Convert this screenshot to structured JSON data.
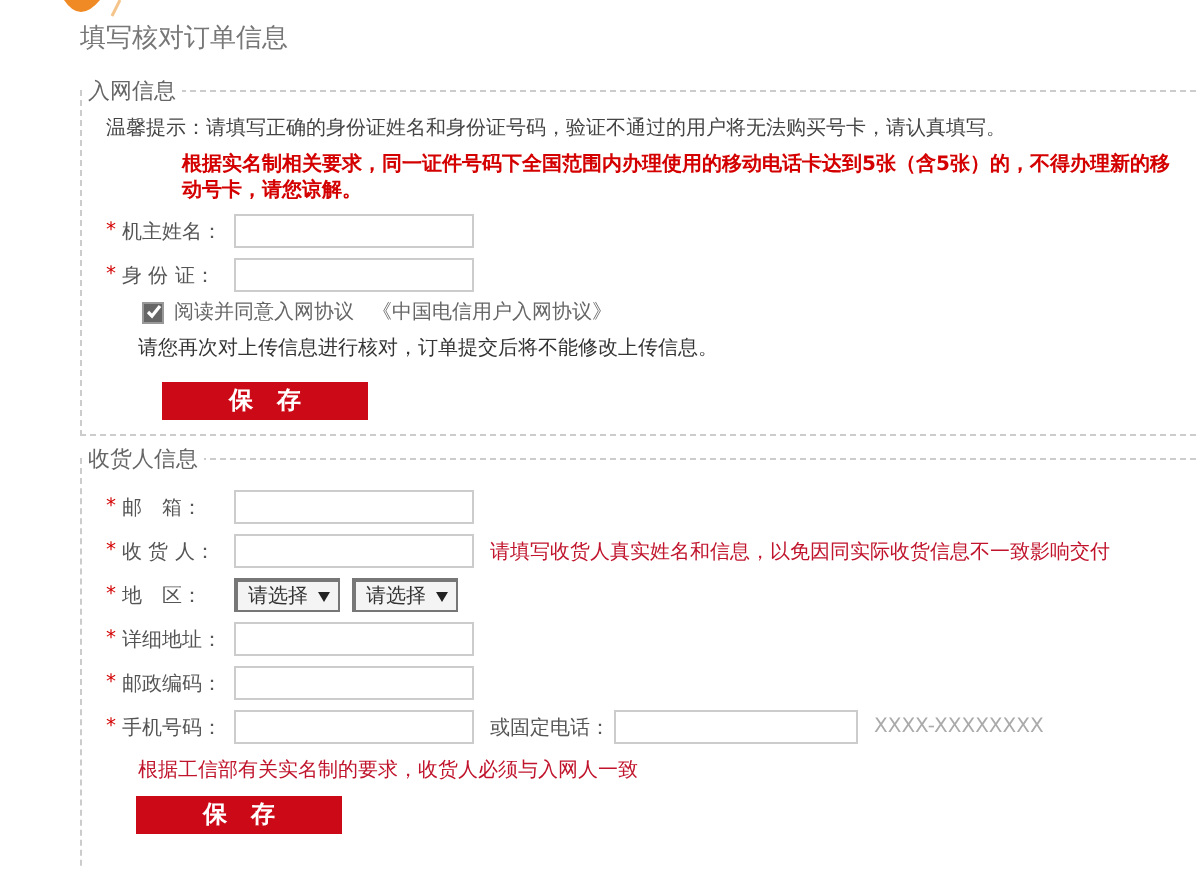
{
  "header": {
    "title": "填写核对订单信息"
  },
  "sections": [
    {
      "legend": "入网信息",
      "hint": "温馨提示：请填写正确的身份证姓名和身份证号码，验证不通过的用户将无法购买号卡，请认真填写。",
      "warning": "根据实名制相关要求，同一证件号码下全国范围内办理使用的移动电话卡达到5张（含5张）的，不得办理新的移动号卡，请您谅解。",
      "fields": [
        {
          "kind": "text",
          "label": "机主姓名：",
          "mark": "*"
        },
        {
          "kind": "text",
          "label": "身 份 证：",
          "mark": "*"
        }
      ],
      "agreement": {
        "checked": true,
        "text": "阅读并同意入网协议",
        "link": "《中国电信用户入网协议》"
      },
      "note": "请您再次对上传信息进行核对，订单提交后将不能修改上传信息。",
      "button": "保　存"
    },
    {
      "legend": "收货人信息",
      "fields": [
        {
          "kind": "text",
          "label": "邮　箱：",
          "mark": "*"
        },
        {
          "kind": "text",
          "label": "收 货 人：",
          "mark": "*",
          "tip": "请填写收货人真实姓名和信息，以免因同实际收货信息不一致影响交付"
        },
        {
          "kind": "select",
          "label": "地　区：",
          "mark": "*",
          "selects": [
            "请选择",
            "请选择"
          ]
        },
        {
          "kind": "text",
          "label": "详细地址：",
          "mark": "*"
        },
        {
          "kind": "text",
          "label": "邮政编码：",
          "mark": "*"
        },
        {
          "kind": "phone",
          "label": "手机号码：",
          "mark": "*",
          "alt_label": "或固定电话：",
          "format": "XXXX-XXXXXXXX"
        }
      ],
      "footer_warning": "根据工信部有关实名制的要求，收货人必须与入网人一致",
      "button": "保　存"
    }
  ]
}
